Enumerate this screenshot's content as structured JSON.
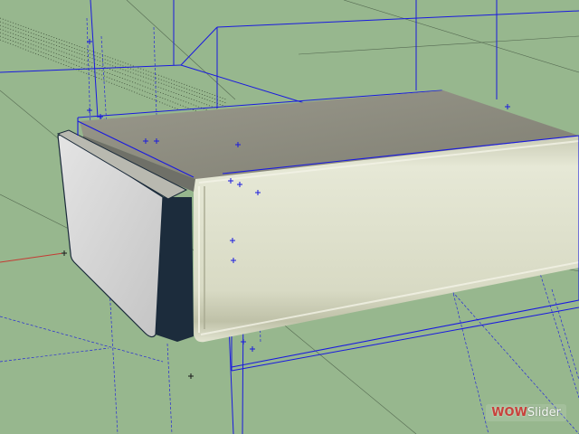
{
  "viewport": {
    "background": "#97b78e",
    "guide_line_color": "#1a1adf",
    "axis_red_color": "#c43b34",
    "axis_dark_color": "#3a4a38"
  },
  "model": {
    "box_top_color": "#8d8c80",
    "box_front_color": "#d7d8c4",
    "cap_face_color": "#d5d5d5",
    "cap_edge_color": "#1a2a3a"
  },
  "watermark": {
    "mark": "WOW",
    "rest": "Slider"
  }
}
